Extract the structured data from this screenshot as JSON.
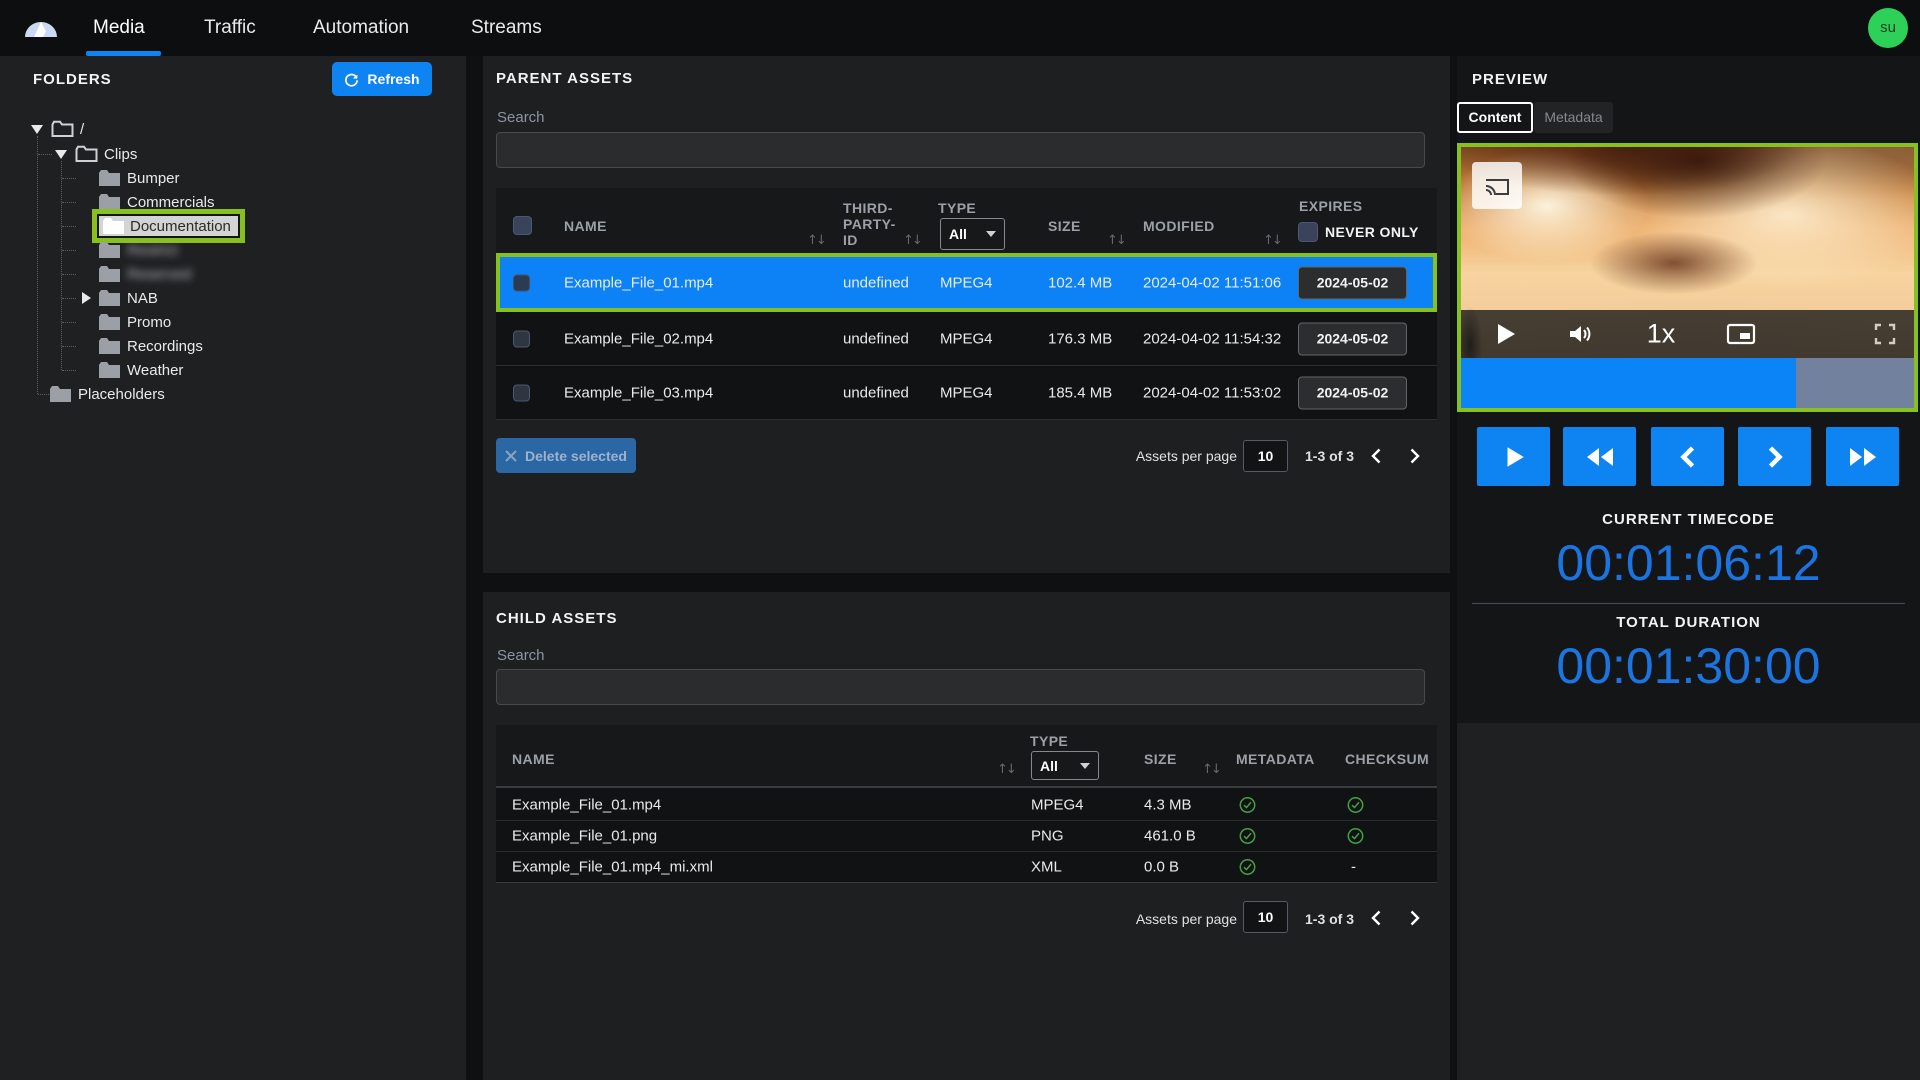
{
  "nav": {
    "tabs": [
      {
        "label": "Media",
        "active": true
      },
      {
        "label": "Traffic",
        "active": false
      },
      {
        "label": "Automation",
        "active": false
      },
      {
        "label": "Streams",
        "active": false
      }
    ],
    "avatar": "su"
  },
  "sidebar": {
    "title": "FOLDERS",
    "refresh_label": "Refresh",
    "tree": [
      {
        "label": "/",
        "depth": 0,
        "expanded": true
      },
      {
        "label": "Clips",
        "depth": 1,
        "expanded": true
      },
      {
        "label": "Bumper",
        "depth": 2
      },
      {
        "label": "Commercials",
        "depth": 2
      },
      {
        "label": "Documentation",
        "depth": 2,
        "selected": true
      },
      {
        "label": "",
        "depth": 2,
        "blurred": true
      },
      {
        "label": "",
        "depth": 2,
        "blurred": true
      },
      {
        "label": "NAB",
        "depth": 2,
        "collapsed": true
      },
      {
        "label": "Promo",
        "depth": 2
      },
      {
        "label": "Recordings",
        "depth": 2
      },
      {
        "label": "Weather",
        "depth": 2
      },
      {
        "label": "Placeholders",
        "depth": 0
      }
    ]
  },
  "parent_assets": {
    "title": "PARENT ASSETS",
    "search_label": "Search",
    "search_value": "",
    "columns": {
      "name": "NAME",
      "third_party_id_l1": "THIRD-",
      "third_party_id_l2": "PARTY-",
      "third_party_id_l3": "ID",
      "type": "TYPE",
      "type_filter": "All",
      "size": "SIZE",
      "modified": "MODIFIED",
      "expires": "EXPIRES",
      "never_only": "NEVER ONLY"
    },
    "rows": [
      {
        "name": "Example_File_01.mp4",
        "third_party_id": "undefined",
        "type": "MPEG4",
        "size": "102.4 MB",
        "modified": "2024-04-02 11:51:06",
        "expires": "2024-05-02",
        "selected": true
      },
      {
        "name": "Example_File_02.mp4",
        "third_party_id": "undefined",
        "type": "MPEG4",
        "size": "176.3 MB",
        "modified": "2024-04-02 11:54:32",
        "expires": "2024-05-02",
        "selected": false
      },
      {
        "name": "Example_File_03.mp4",
        "third_party_id": "undefined",
        "type": "MPEG4",
        "size": "185.4 MB",
        "modified": "2024-04-02 11:53:02",
        "expires": "2024-05-02",
        "selected": false
      }
    ],
    "delete_button": "Delete selected",
    "pagination": {
      "label": "Assets per page",
      "per_page": "10",
      "range": "1-3 of 3"
    }
  },
  "child_assets": {
    "title": "CHILD ASSETS",
    "search_label": "Search",
    "search_value": "",
    "columns": {
      "name": "NAME",
      "type": "TYPE",
      "type_filter": "All",
      "size": "SIZE",
      "metadata": "METADATA",
      "checksum": "CHECKSUM"
    },
    "rows": [
      {
        "name": "Example_File_01.mp4",
        "type": "MPEG4",
        "size": "4.3 MB",
        "metadata": "check",
        "checksum": "check"
      },
      {
        "name": "Example_File_01.png",
        "type": "PNG",
        "size": "461.0 B",
        "metadata": "check",
        "checksum": "check"
      },
      {
        "name": "Example_File_01.mp4_mi.xml",
        "type": "XML",
        "size": "0.0 B",
        "metadata": "check",
        "checksum": "-"
      }
    ],
    "pagination": {
      "label": "Assets per page",
      "per_page": "10",
      "range": "1-3 of 3"
    }
  },
  "preview": {
    "title": "PREVIEW",
    "tabs": {
      "content": "Content",
      "metadata": "Metadata"
    },
    "player": {
      "speed": "1x",
      "progress_pct": 74
    },
    "current_timecode_label": "CURRENT TIMECODE",
    "current_timecode": "00:01:06:12",
    "total_duration_label": "TOTAL DURATION",
    "total_duration": "00:01:30:00"
  },
  "colors": {
    "accent_blue": "#0d84f2",
    "row_blue": "#0c82f6",
    "highlight_green": "#86c11f",
    "timecode_blue": "#1b74e0",
    "avatar_green": "#2ed157"
  }
}
